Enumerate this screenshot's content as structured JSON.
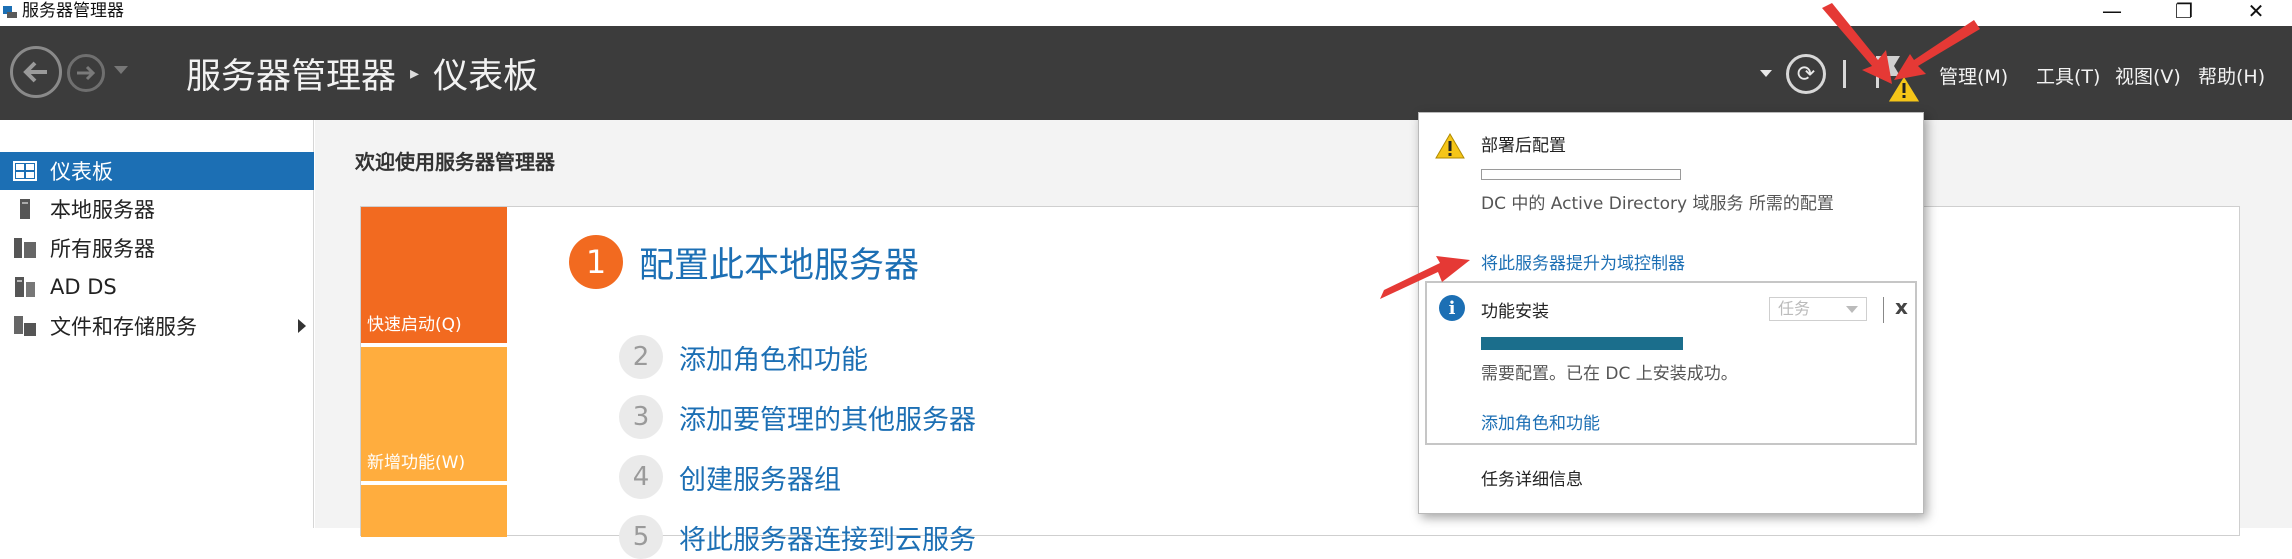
{
  "window": {
    "title": "服务器管理器",
    "min": "—",
    "max": "❐",
    "close": "✕"
  },
  "header": {
    "breadcrumb_root": "服务器管理器",
    "breadcrumb_sep": "▸",
    "breadcrumb_current": "仪表板",
    "refresh_icon": "⟳",
    "menus": [
      "管理(M)",
      "工具(T)",
      "视图(V)",
      "帮助(H)"
    ]
  },
  "sidebar": {
    "items": [
      {
        "label": "仪表板",
        "icon": "dashboard-icon",
        "active": true
      },
      {
        "label": "本地服务器",
        "icon": "local-server-icon",
        "active": false
      },
      {
        "label": "所有服务器",
        "icon": "all-servers-icon",
        "active": false
      },
      {
        "label": "AD DS",
        "icon": "ad-ds-icon",
        "active": false
      },
      {
        "label": "文件和存储服务",
        "icon": "file-storage-icon",
        "active": false,
        "expandable": true
      }
    ]
  },
  "main": {
    "welcome": "欢迎使用服务器管理器",
    "tiles": {
      "quick_start": "快速启动(Q)",
      "new_features": "新增功能(W)"
    },
    "steps": [
      {
        "num": "1",
        "label": "配置此本地服务器"
      },
      {
        "num": "2",
        "label": "添加角色和功能"
      },
      {
        "num": "3",
        "label": "添加要管理的其他服务器"
      },
      {
        "num": "4",
        "label": "创建服务器组"
      },
      {
        "num": "5",
        "label": "将此服务器连接到云服务"
      }
    ]
  },
  "notifications": {
    "post_deploy": {
      "title": "部署后配置",
      "progress": 0,
      "desc": "DC 中的 Active Directory 域服务 所需的配置",
      "link": "将此服务器提升为域控制器"
    },
    "feature_install": {
      "title": "功能安装",
      "task_label": "任务",
      "close": "x",
      "progress": 1.0,
      "desc": "需要配置。已在 DC 上安装成功。",
      "link": "添加角色和功能"
    },
    "task_details": "任务详细信息"
  },
  "colors": {
    "accent_blue": "#1c6fb4",
    "header_bg": "#3c3c3c",
    "tile_orange": "#f26a20",
    "tile_light_orange": "#ffad3e",
    "progress_teal": "#1b6e8c",
    "warning_yellow": "#f5c518",
    "annotation_red": "#e53935"
  }
}
